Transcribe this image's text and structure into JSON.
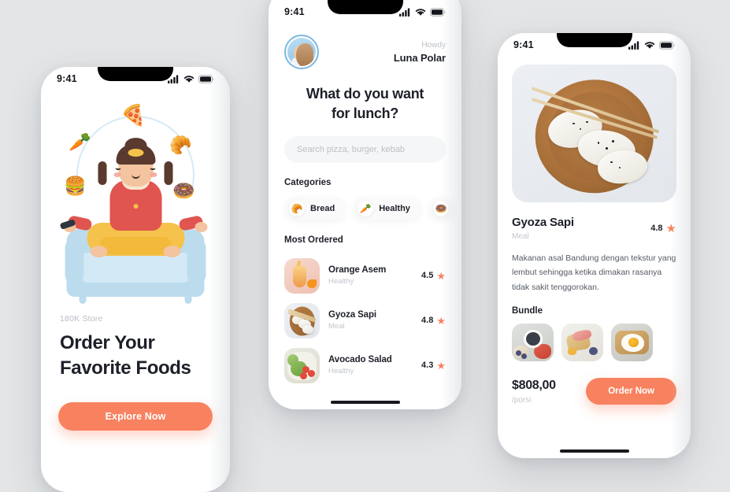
{
  "meta": {
    "accent": "#f8815f",
    "background": "#e3e5e6",
    "text_dark": "#1d2028",
    "text_muted": "#c2c6cc"
  },
  "status_bar": {
    "time": "9:41",
    "cellular_icon": "cellular-icon",
    "wifi_icon": "wifi-icon",
    "battery_icon": "battery-icon"
  },
  "screen_onboarding": {
    "store_label": "180K Store",
    "heading_line1": "Order Your",
    "heading_line2": "Favorite Foods",
    "cta_label": "Explore Now",
    "illustration": {
      "name": "meditating-woman-illustration",
      "foods": [
        "pizza-icon",
        "carrot-icon",
        "croissant-icon",
        "burger-icon",
        "donut-icon"
      ],
      "food_glyphs": [
        "🍕",
        "🥕",
        "🥐",
        "🍔",
        "🍩"
      ]
    }
  },
  "screen_home": {
    "greeting_small": "Howdy",
    "user_name": "Luna Polar",
    "avatar": "user-avatar",
    "question_line1": "What do you want",
    "question_line2": "for lunch?",
    "search": {
      "placeholder": "Search pizza, burger, kebab",
      "value": ""
    },
    "categories_title": "Categories",
    "categories": [
      {
        "label": "Bread",
        "icon": "croissant-icon",
        "glyph": "🥐"
      },
      {
        "label": "Healthy",
        "icon": "carrot-icon",
        "glyph": "🥕"
      },
      {
        "label": "",
        "icon": "donut-icon",
        "glyph": "🍩"
      }
    ],
    "most_ordered_title": "Most Ordered",
    "most_ordered": [
      {
        "name": "Orange Asem",
        "category": "Healthy",
        "rating": "4.5",
        "thumb": "orange-drink-photo"
      },
      {
        "name": "Gyoza Sapi",
        "category": "Meal",
        "rating": "4.8",
        "thumb": "gyoza-photo"
      },
      {
        "name": "Avocado Salad",
        "category": "Healthy",
        "rating": "4.3",
        "thumb": "avocado-salad-photo"
      }
    ]
  },
  "screen_detail": {
    "hero_image": "gyoza-bowl-photo",
    "title": "Gyoza Sapi",
    "category": "Meal",
    "rating": "4.8",
    "description": "Makanan asal Bandung dengan tekstur yang lembut sehingga ketika dimakan rasanya tidak sakit tenggorokan.",
    "bundle_title": "Bundle",
    "bundle": [
      {
        "name": "bundle-item-granola-bowl"
      },
      {
        "name": "bundle-item-toast-platter"
      },
      {
        "name": "bundle-item-egg-toast"
      }
    ],
    "price": "$808,00",
    "price_unit": "/porsi",
    "order_label": "Order Now"
  }
}
